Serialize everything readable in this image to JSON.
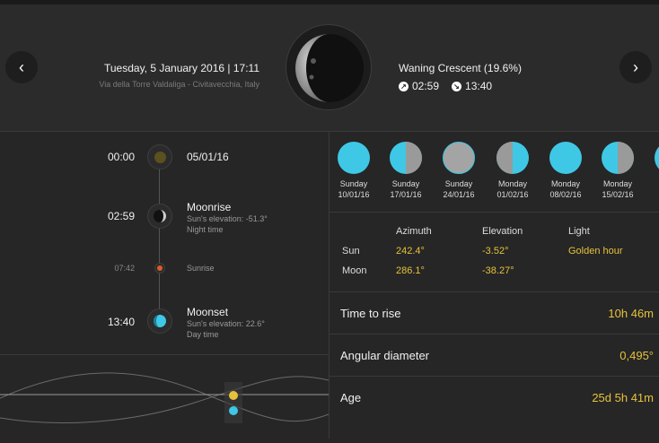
{
  "header": {
    "date_time": "Tuesday, 5 January 2016 | 17:11",
    "location": "Via della Torre Valdaliga - Civitavecchia, Italy",
    "phase": "Waning Crescent (19.6%)",
    "rise_time": "02:59",
    "set_time": "13:40",
    "prev_icon": "chevron-left-icon",
    "next_icon": "chevron-right-icon"
  },
  "timeline": {
    "events": [
      {
        "time": "00:00",
        "title": "05/01/16",
        "sub1": "",
        "sub2": ""
      },
      {
        "time": "02:59",
        "title": "Moonrise",
        "sub1": "Sun's elevation: -51.3°",
        "sub2": "Night time"
      },
      {
        "time": "07:42",
        "title": "Sunrise",
        "sub1": "",
        "sub2": ""
      },
      {
        "time": "13:40",
        "title": "Moonset",
        "sub1": "Sun's elevation: 22.6°",
        "sub2": "Day time"
      }
    ]
  },
  "phase_calendar": [
    {
      "day": "Sunday",
      "date": "10/01/16",
      "phase": "new"
    },
    {
      "day": "Sunday",
      "date": "17/01/16",
      "phase": "first-quarter"
    },
    {
      "day": "Sunday",
      "date": "24/01/16",
      "phase": "full"
    },
    {
      "day": "Monday",
      "date": "01/02/16",
      "phase": "last-quarter"
    },
    {
      "day": "Monday",
      "date": "08/02/16",
      "phase": "new"
    },
    {
      "day": "Monday",
      "date": "15/02/16",
      "phase": "first-quarter"
    }
  ],
  "position_table": {
    "headers": [
      "Azimuth",
      "Elevation",
      "Light"
    ],
    "rows": [
      {
        "label": "Sun",
        "azimuth": "242.4°",
        "elevation": "-3.52°",
        "light": "Golden hour"
      },
      {
        "label": "Moon",
        "azimuth": "286.1°",
        "elevation": "-38.27°",
        "light": ""
      }
    ]
  },
  "info": [
    {
      "label": "Time to rise",
      "value": "10h 46m"
    },
    {
      "label": "Angular diameter",
      "value": "0,495°"
    },
    {
      "label": "Age",
      "value": "25d 5h 41m"
    }
  ],
  "colors": {
    "accent_cyan": "#3ec8e6",
    "accent_gold": "#e6c23a",
    "sunrise_orange": "#e05a2a"
  }
}
